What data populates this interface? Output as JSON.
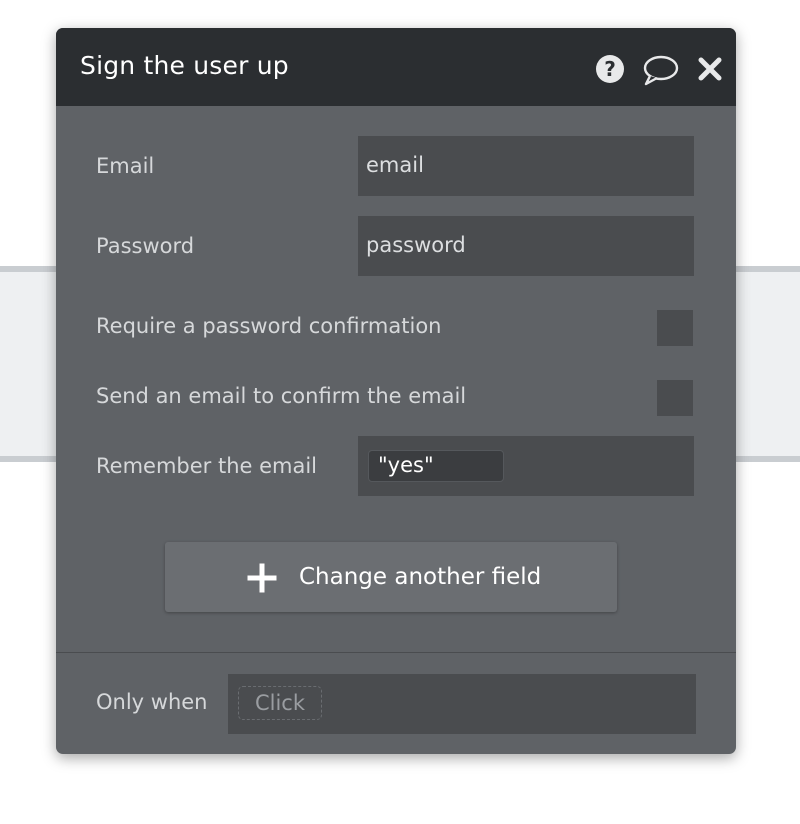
{
  "dialog": {
    "title": "Sign the user up",
    "header_icons": [
      "help-icon",
      "comment-icon",
      "close-icon"
    ]
  },
  "fields": {
    "email": {
      "label": "Email",
      "value": "email"
    },
    "password": {
      "label": "Password",
      "value": "password"
    },
    "require_confirmation": {
      "label": "Require a password confirmation",
      "checked": false
    },
    "send_email": {
      "label": "Send an email to confirm the email",
      "checked": false
    },
    "remember": {
      "label": "Remember the email",
      "value": "\"yes\""
    }
  },
  "change_button": {
    "label": "Change another field",
    "icon": "plus-icon"
  },
  "condition": {
    "label": "Only when",
    "placeholder": "Click"
  },
  "colors": {
    "header_bg": "#2b2e31",
    "panel_bg": "#5f6266",
    "field_bg": "#4a4c4f",
    "button_bg": "#6b6e72"
  }
}
